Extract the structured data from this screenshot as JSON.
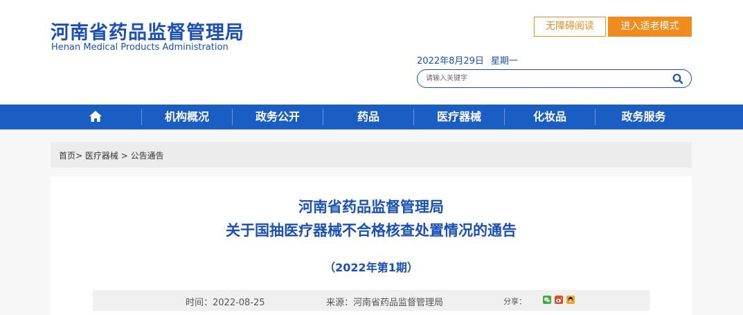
{
  "header": {
    "logo_cn": "河南省药品监督管理局",
    "logo_en": "Henan Medical Products Administration",
    "accessibility_button": "无障碍阅读",
    "elder_mode_button": "进入适老模式",
    "date": "2022年8月29日",
    "weekday": "星期一",
    "search_placeholder": "请输入关键字"
  },
  "nav": {
    "items": [
      {
        "label": "机构概况"
      },
      {
        "label": "政务公开"
      },
      {
        "label": "药品"
      },
      {
        "label": "医疗器械"
      },
      {
        "label": "化妆品"
      },
      {
        "label": "政务服务"
      }
    ]
  },
  "breadcrumb": {
    "home": "首页",
    "sep1": ">",
    "section": "医疗器械",
    "sep2": ">",
    "current": "公告通告"
  },
  "article": {
    "title_line1": "河南省药品监督管理局",
    "title_line2": "关于国抽医疗器械不合格核查处置情况的通告",
    "issue": "（2022年第1期）",
    "time_label": "时间：",
    "time_value": "2022-08-25",
    "source_label": "来源：",
    "source_value": "河南省药品监督管理局",
    "share_label": "分享："
  },
  "colors": {
    "brand_blue": "#1a4fb5",
    "nav_blue": "#1a5ec4",
    "accent_orange": "#f08c1e"
  }
}
